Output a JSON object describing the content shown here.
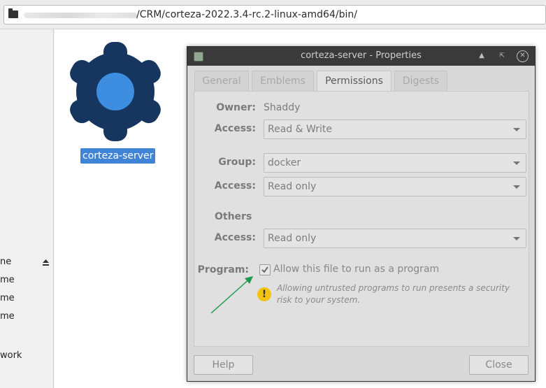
{
  "location": {
    "path": "/CRM/corteza-2022.3.4-rc.2-linux-amd64/bin/"
  },
  "side_pane": {
    "items": [
      {
        "label": "ne"
      },
      {
        "label": "me"
      },
      {
        "label": "me"
      },
      {
        "label": "me"
      },
      {
        "label": "work"
      }
    ]
  },
  "file": {
    "name": "corteza-server",
    "icon": "gear-icon",
    "icon_color": "#17365f",
    "icon_center_color": "#3d8ee0"
  },
  "dialog": {
    "title": "corteza-server - Properties",
    "tabs": [
      {
        "label": "General"
      },
      {
        "label": "Emblems"
      },
      {
        "label": "Permissions",
        "active": true
      },
      {
        "label": "Digests"
      }
    ],
    "permissions": {
      "owner_label": "Owner:",
      "owner_value": "Shaddy",
      "owner_access_label": "Access:",
      "owner_access_value": "Read & Write",
      "group_label": "Group:",
      "group_value": "docker",
      "group_access_label": "Access:",
      "group_access_value": "Read only",
      "others_label": "Others",
      "others_access_label": "Access:",
      "others_access_value": "Read only",
      "program_label": "Program:",
      "program_checkbox_label": "Allow this file to run as a program",
      "program_checked": true,
      "warning_text": "Allowing untrusted programs to run presents a security risk to your system."
    },
    "buttons": {
      "help": "Help",
      "close": "Close"
    }
  },
  "colors": {
    "annotation_arrow": "#1a9a4a",
    "selection": "#3f84d6",
    "warning": "#f1c40f"
  }
}
